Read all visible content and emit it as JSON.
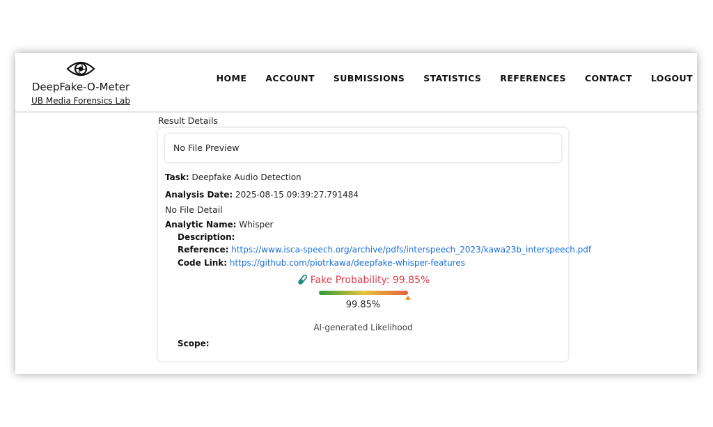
{
  "header": {
    "brand": "DeepFake-O-Meter",
    "lab": "UB Media Forensics Lab",
    "nav": [
      "HOME",
      "ACCOUNT",
      "SUBMISSIONS",
      "STATISTICS",
      "REFERENCES",
      "CONTACT",
      "LOGOUT"
    ]
  },
  "result": {
    "section_title": "Result Details",
    "preview": "No File Preview",
    "task_label": "Task:",
    "task": "Deepfake Audio Detection",
    "date_label": "Analysis Date:",
    "date": "2025-08-15 09:39:27.791484",
    "file_detail": "No File Detail",
    "analytic_label": "Analytic Name:",
    "analytic": "Whisper",
    "description_label": "Description:",
    "reference_label": "Reference:",
    "reference": "https://www.isca-speech.org/archive/pdfs/interspeech_2023/kawa23b_interspeech.pdf",
    "code_label": "Code Link:",
    "code": "https://github.com/piotrkawa/deepfake-whisper-features",
    "probability_text": "Fake Probability: 99.85%",
    "probability": 99.85,
    "probability_display": "99.85%",
    "likelihood_label": "AI-generated Likelihood",
    "scope_label": "Scope:"
  },
  "icons": {
    "logo": "eye-shutter-icon",
    "probability": "test-tube-icon"
  },
  "colors": {
    "probability_text": "#d93c4a",
    "link": "#1a6fd6",
    "marker": "#e8902a"
  }
}
